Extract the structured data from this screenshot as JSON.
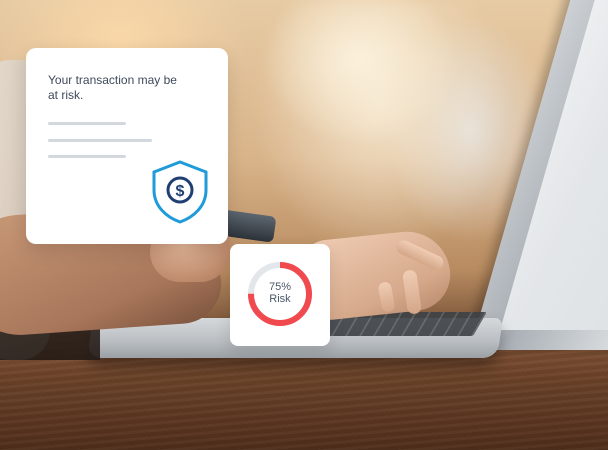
{
  "alert_card": {
    "message": "Your transaction may be at risk.",
    "icon": "shield-dollar-icon",
    "accent_color": "#1f9bd9",
    "icon_color": "#1f3f72"
  },
  "risk_card": {
    "percent_label": "75%",
    "risk_label": "Risk",
    "risk_fraction": 0.75,
    "gauge_color": "#f04a4f",
    "track_color": "#e3e6ea",
    "icon": "risk-gauge"
  },
  "scene": {
    "description_icons": [
      "laptop",
      "phone",
      "hands"
    ]
  }
}
